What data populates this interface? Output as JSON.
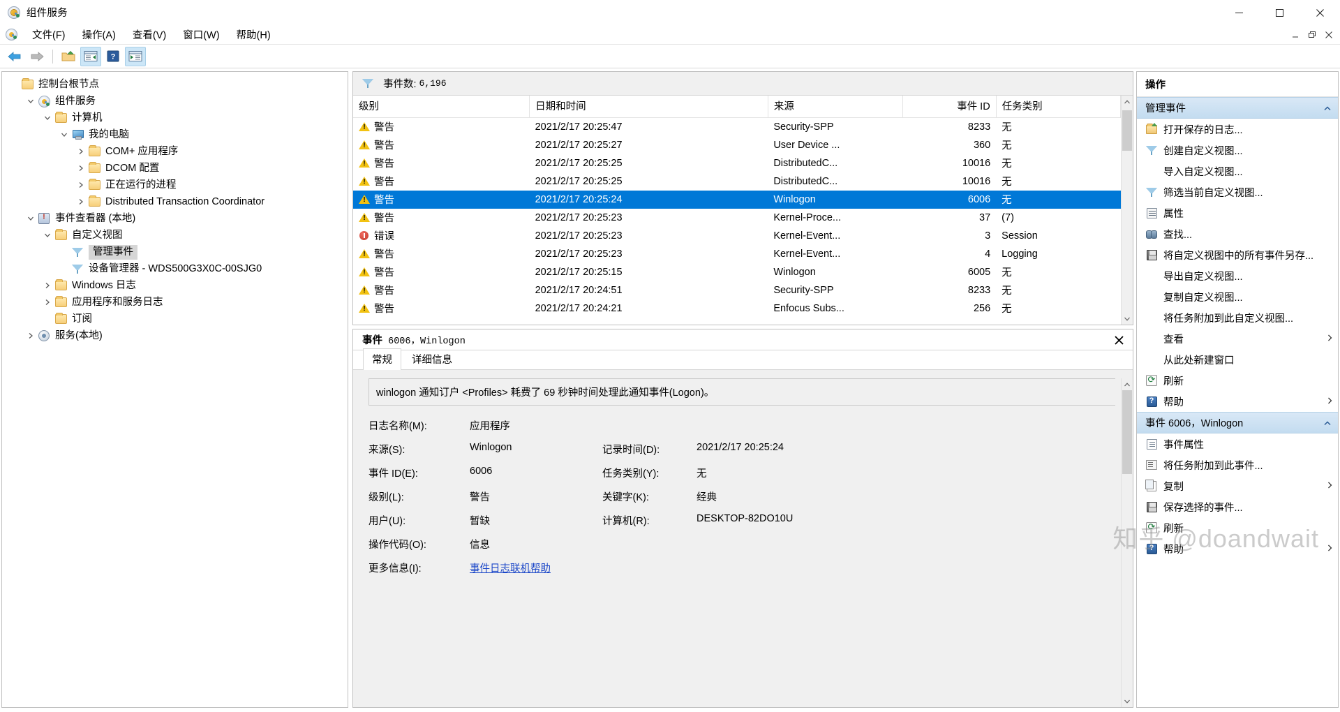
{
  "window": {
    "title": "组件服务",
    "app_icon": "mmc-icon",
    "controls": {
      "minimize": "minimize-icon",
      "maximize": "maximize-icon",
      "close": "close-icon"
    }
  },
  "menubar": {
    "items": [
      {
        "label": "文件(F)",
        "name": "menu-file"
      },
      {
        "label": "操作(A)",
        "name": "menu-action"
      },
      {
        "label": "查看(V)",
        "name": "menu-view"
      },
      {
        "label": "窗口(W)",
        "name": "menu-window"
      },
      {
        "label": "帮助(H)",
        "name": "menu-help"
      }
    ],
    "mdi": {
      "minimize": "mdi-minimize-icon",
      "restore": "mdi-restore-icon",
      "close": "mdi-close-icon"
    }
  },
  "toolbar": {
    "buttons": [
      {
        "name": "back-button",
        "icon": "back-arrow-icon",
        "active": false
      },
      {
        "name": "forward-button",
        "icon": "forward-arrow-icon",
        "active": false
      },
      {
        "name": "up-folder-button",
        "icon": "up-folder-icon",
        "active": false
      },
      {
        "name": "show-hide-tree-button",
        "icon": "tree-pane-icon",
        "active": true
      },
      {
        "name": "help-button",
        "icon": "help-icon",
        "active": false
      },
      {
        "name": "show-hide-action-button",
        "icon": "action-pane-icon",
        "active": true
      }
    ]
  },
  "tree": {
    "items": [
      {
        "label": "控制台根节点",
        "icon": "folder-icon",
        "indent": 0,
        "twisty": "none",
        "selected": false
      },
      {
        "label": "组件服务",
        "icon": "mmc-icon",
        "indent": 1,
        "twisty": "expanded",
        "selected": false
      },
      {
        "label": "计算机",
        "icon": "folder-icon",
        "indent": 2,
        "twisty": "expanded",
        "selected": false
      },
      {
        "label": "我的电脑",
        "icon": "monitor-icon",
        "indent": 3,
        "twisty": "expanded",
        "selected": false
      },
      {
        "label": "COM+ 应用程序",
        "icon": "folder-icon",
        "indent": 4,
        "twisty": "collapsed",
        "selected": false
      },
      {
        "label": "DCOM 配置",
        "icon": "folder-icon",
        "indent": 4,
        "twisty": "collapsed",
        "selected": false
      },
      {
        "label": "正在运行的进程",
        "icon": "folder-icon",
        "indent": 4,
        "twisty": "collapsed",
        "selected": false
      },
      {
        "label": "Distributed Transaction Coordinator",
        "icon": "folder-icon",
        "indent": 4,
        "twisty": "collapsed",
        "selected": false
      },
      {
        "label": "事件查看器 (本地)",
        "icon": "event-viewer-icon",
        "indent": 1,
        "twisty": "expanded",
        "selected": false
      },
      {
        "label": "自定义视图",
        "icon": "custom-view-folder-icon",
        "indent": 2,
        "twisty": "expanded",
        "selected": false
      },
      {
        "label": "管理事件",
        "icon": "funnel-icon",
        "indent": 3,
        "twisty": "none",
        "selected": true
      },
      {
        "label": "设备管理器 - WDS500G3X0C-00SJG0",
        "icon": "funnel-icon",
        "indent": 3,
        "twisty": "none",
        "selected": false
      },
      {
        "label": "Windows 日志",
        "icon": "logs-folder-icon",
        "indent": 2,
        "twisty": "collapsed",
        "selected": false
      },
      {
        "label": "应用程序和服务日志",
        "icon": "logs-folder-icon",
        "indent": 2,
        "twisty": "collapsed",
        "selected": false
      },
      {
        "label": "订阅",
        "icon": "folder-icon",
        "indent": 2,
        "twisty": "none",
        "selected": false
      },
      {
        "label": "服务(本地)",
        "icon": "services-gear-icon",
        "indent": 1,
        "twisty": "collapsed",
        "selected": false
      }
    ]
  },
  "event_list": {
    "filter_icon": "funnel-icon",
    "count_label": "事件数:",
    "count_value": "6,196",
    "columns": [
      {
        "label": "级别",
        "name": "column-level",
        "align": "left"
      },
      {
        "label": "日期和时间",
        "name": "column-datetime",
        "align": "left"
      },
      {
        "label": "来源",
        "name": "column-source",
        "align": "left"
      },
      {
        "label": "事件 ID",
        "name": "column-event-id",
        "align": "right"
      },
      {
        "label": "任务类别",
        "name": "column-task-category",
        "align": "left"
      }
    ],
    "rows": [
      {
        "level": "警告",
        "level_icon": "warning-icon",
        "datetime": "2021/2/17 20:25:47",
        "source": "Security-SPP",
        "event_id": "8233",
        "task": "无",
        "selected": false
      },
      {
        "level": "警告",
        "level_icon": "warning-icon",
        "datetime": "2021/2/17 20:25:27",
        "source": "User Device ...",
        "event_id": "360",
        "task": "无",
        "selected": false
      },
      {
        "level": "警告",
        "level_icon": "warning-icon",
        "datetime": "2021/2/17 20:25:25",
        "source": "DistributedC...",
        "event_id": "10016",
        "task": "无",
        "selected": false
      },
      {
        "level": "警告",
        "level_icon": "warning-icon",
        "datetime": "2021/2/17 20:25:25",
        "source": "DistributedC...",
        "event_id": "10016",
        "task": "无",
        "selected": false
      },
      {
        "level": "警告",
        "level_icon": "warning-icon",
        "datetime": "2021/2/17 20:25:24",
        "source": "Winlogon",
        "event_id": "6006",
        "task": "无",
        "selected": true
      },
      {
        "level": "警告",
        "level_icon": "warning-icon",
        "datetime": "2021/2/17 20:25:23",
        "source": "Kernel-Proce...",
        "event_id": "37",
        "task": "(7)",
        "selected": false
      },
      {
        "level": "错误",
        "level_icon": "error-icon",
        "datetime": "2021/2/17 20:25:23",
        "source": "Kernel-Event...",
        "event_id": "3",
        "task": "Session",
        "selected": false
      },
      {
        "level": "警告",
        "level_icon": "warning-icon",
        "datetime": "2021/2/17 20:25:23",
        "source": "Kernel-Event...",
        "event_id": "4",
        "task": "Logging",
        "selected": false
      },
      {
        "level": "警告",
        "level_icon": "warning-icon",
        "datetime": "2021/2/17 20:25:15",
        "source": "Winlogon",
        "event_id": "6005",
        "task": "无",
        "selected": false
      },
      {
        "level": "警告",
        "level_icon": "warning-icon",
        "datetime": "2021/2/17 20:24:51",
        "source": "Security-SPP",
        "event_id": "8233",
        "task": "无",
        "selected": false
      },
      {
        "level": "警告",
        "level_icon": "warning-icon",
        "datetime": "2021/2/17 20:24:21",
        "source": "Enfocus Subs...",
        "event_id": "256",
        "task": "无",
        "selected": false
      }
    ]
  },
  "detail": {
    "header_prefix": "事件",
    "header_rest": "6006，Winlogon",
    "close_icon": "close-icon",
    "tabs": [
      {
        "label": "常规",
        "name": "tab-general",
        "active": true
      },
      {
        "label": "详细信息",
        "name": "tab-details",
        "active": false
      }
    ],
    "message": "winlogon 通知订户 <Profiles> 耗费了 69 秒钟时间处理此通知事件(Logon)。",
    "fields": [
      {
        "label": "日志名称(M):",
        "value": "应用程序",
        "label2": "",
        "value2": ""
      },
      {
        "label": "来源(S):",
        "value": "Winlogon",
        "label2": "记录时间(D):",
        "value2": "2021/2/17 20:25:24"
      },
      {
        "label": "事件 ID(E):",
        "value": "6006",
        "label2": "任务类别(Y):",
        "value2": "无"
      },
      {
        "label": "级别(L):",
        "value": "警告",
        "label2": "关键字(K):",
        "value2": "经典"
      },
      {
        "label": "用户(U):",
        "value": "暂缺",
        "label2": "计算机(R):",
        "value2": "DESKTOP-82DO10U"
      },
      {
        "label": "操作代码(O):",
        "value": "信息",
        "label2": "",
        "value2": ""
      },
      {
        "label": "更多信息(I):",
        "value": "事件日志联机帮助",
        "label2": "",
        "value2": "",
        "link": true
      }
    ]
  },
  "actions": {
    "title": "操作",
    "groups": [
      {
        "name": "actions-group-manage-events",
        "header": "管理事件",
        "collapse_icon": "chevron-up-icon",
        "items": [
          {
            "label": "打开保存的日志...",
            "icon": "open-saved-log-icon",
            "name": "action-open-saved-log",
            "submenu": false
          },
          {
            "label": "创建自定义视图...",
            "icon": "create-custom-view-icon",
            "name": "action-create-custom-view",
            "submenu": false
          },
          {
            "label": "导入自定义视图...",
            "icon": "none",
            "name": "action-import-custom-view",
            "submenu": false
          },
          {
            "label": "筛选当前自定义视图...",
            "icon": "filter-icon",
            "name": "action-filter-current-custom-view",
            "submenu": false
          },
          {
            "label": "属性",
            "icon": "properties-icon",
            "name": "action-properties",
            "submenu": false
          },
          {
            "label": "查找...",
            "icon": "find-icon",
            "name": "action-find",
            "submenu": false
          },
          {
            "label": "将自定义视图中的所有事件另存...",
            "icon": "save-icon",
            "name": "action-save-all-events",
            "submenu": false
          },
          {
            "label": "导出自定义视图...",
            "icon": "none",
            "name": "action-export-custom-view",
            "submenu": false
          },
          {
            "label": "复制自定义视图...",
            "icon": "none",
            "name": "action-copy-custom-view",
            "submenu": false
          },
          {
            "label": "将任务附加到此自定义视图...",
            "icon": "none",
            "name": "action-attach-task-to-view",
            "submenu": false
          },
          {
            "label": "查看",
            "icon": "none",
            "name": "action-view",
            "submenu": true
          },
          {
            "label": "从此处新建窗口",
            "icon": "none",
            "name": "action-new-window-from-here",
            "submenu": false
          },
          {
            "label": "刷新",
            "icon": "refresh-icon",
            "name": "action-refresh",
            "submenu": false
          },
          {
            "label": "帮助",
            "icon": "help-icon",
            "name": "action-help",
            "submenu": true
          }
        ]
      },
      {
        "name": "actions-group-event-6006",
        "header": "事件 6006，Winlogon",
        "collapse_icon": "chevron-up-icon",
        "items": [
          {
            "label": "事件属性",
            "icon": "event-properties-icon",
            "name": "action-event-properties",
            "submenu": false
          },
          {
            "label": "将任务附加到此事件...",
            "icon": "attach-task-icon",
            "name": "action-attach-task-to-event",
            "submenu": false
          },
          {
            "label": "复制",
            "icon": "copy-icon",
            "name": "action-copy",
            "submenu": true
          },
          {
            "label": "保存选择的事件...",
            "icon": "save-icon",
            "name": "action-save-selected-events",
            "submenu": false
          },
          {
            "label": "刷新",
            "icon": "refresh-icon",
            "name": "action-refresh-2",
            "submenu": false
          },
          {
            "label": "帮助",
            "icon": "help-icon",
            "name": "action-help-2",
            "submenu": true
          }
        ]
      }
    ]
  },
  "watermark": "知乎 @doandwait",
  "colors": {
    "selection": "#0078d7",
    "group_header": "#c3dcf0",
    "link": "#1a46c8",
    "warning": "#f2c212",
    "error": "#c0392b"
  }
}
